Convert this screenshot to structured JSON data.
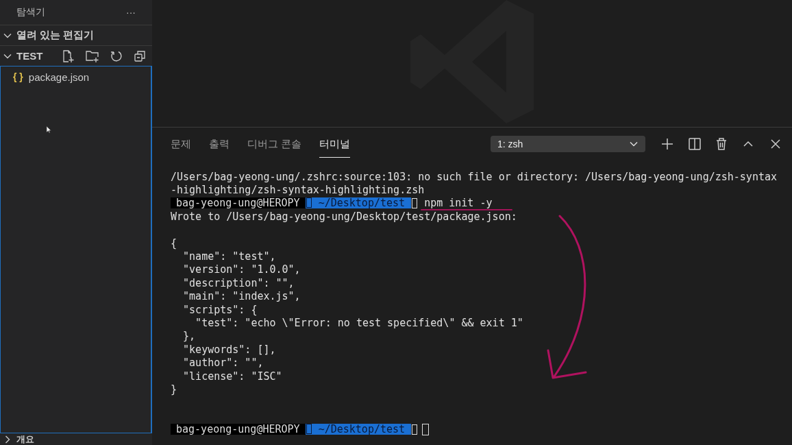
{
  "sidebar": {
    "title": "탐색기",
    "more": "···",
    "sections": [
      {
        "label": "열려 있는 편집기",
        "expanded": true
      },
      {
        "label": "TEST",
        "expanded": true,
        "files": [
          {
            "icon_text": "{ }",
            "name": "package.json",
            "selected": false
          }
        ]
      }
    ],
    "outline": {
      "label": "개요",
      "expanded": false
    }
  },
  "panel": {
    "tabs": [
      {
        "label": "문제",
        "selected": false
      },
      {
        "label": "출력",
        "selected": false
      },
      {
        "label": "디버그 콘솔",
        "selected": false
      },
      {
        "label": "터미널",
        "selected": true
      }
    ],
    "terminal_select": {
      "value": "1: zsh"
    },
    "terminal": [
      {
        "kind": "text",
        "text": "/Users/bag-yeong-ung/.zshrc:source:103: no such file or directory: /Users/bag-yeong-ung/zsh-syntax"
      },
      {
        "kind": "text",
        "text": "-highlighting/zsh-syntax-highlighting.zsh"
      },
      {
        "kind": "prompt",
        "user": "bag-yeong-ung@HEROPY",
        "path": "~/Desktop/test",
        "command": "npm init -y"
      },
      {
        "kind": "text",
        "text": "Wrote to /Users/bag-yeong-ung/Desktop/test/package.json:"
      },
      {
        "kind": "blank"
      },
      {
        "kind": "text",
        "text": "{"
      },
      {
        "kind": "text",
        "text": "  \"name\": \"test\","
      },
      {
        "kind": "text",
        "text": "  \"version\": \"1.0.0\","
      },
      {
        "kind": "text",
        "text": "  \"description\": \"\","
      },
      {
        "kind": "text",
        "text": "  \"main\": \"index.js\","
      },
      {
        "kind": "text",
        "text": "  \"scripts\": {"
      },
      {
        "kind": "text",
        "text": "    \"test\": \"echo \\\"Error: no test specified\\\" && exit 1\""
      },
      {
        "kind": "text",
        "text": "  },"
      },
      {
        "kind": "text",
        "text": "  \"keywords\": [],"
      },
      {
        "kind": "text",
        "text": "  \"author\": \"\","
      },
      {
        "kind": "text",
        "text": "  \"license\": \"ISC\""
      },
      {
        "kind": "text",
        "text": "}"
      },
      {
        "kind": "blank"
      },
      {
        "kind": "blank"
      },
      {
        "kind": "prompt",
        "user": "bag-yeong-ung@HEROPY",
        "path": "~/Desktop/test",
        "cursor": true
      }
    ]
  }
}
